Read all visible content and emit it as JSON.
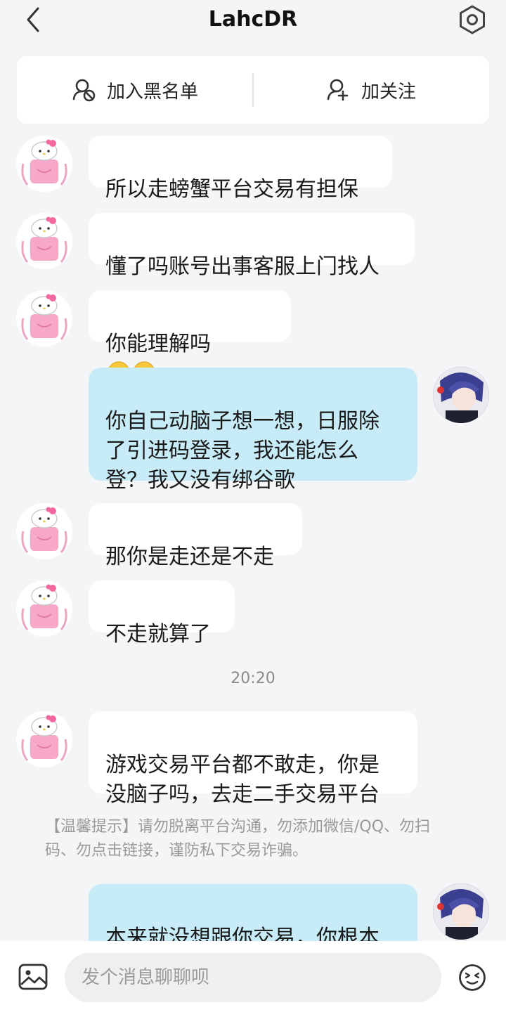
{
  "header": {
    "title": "LahcDR",
    "back_icon": "chevron-left-icon",
    "settings_icon": "gear-icon"
  },
  "actions": {
    "blacklist_label": "加入黑名单",
    "follow_label": "加关注"
  },
  "messages": [
    {
      "side": "in",
      "text": "所以走螃蟹平台交易有担保"
    },
    {
      "side": "in",
      "text": "懂了吗账号出事客服上门找人"
    },
    {
      "side": "in",
      "text": "你能理解吗",
      "emoji": "crying-laughing-emoji"
    },
    {
      "side": "out",
      "text": "你自己动脑子想一想，日服除\n了引进码登录，我还能怎么\n登？我又没有绑谷歌"
    },
    {
      "side": "in",
      "text": "那你是走还是不走"
    },
    {
      "side": "in",
      "text": "不走就算了"
    },
    {
      "side": "in",
      "text": "游戏交易平台都不敢走，你是\n没脑子吗，去走二手交易平台"
    },
    {
      "side": "out",
      "text": "本来就没想跟你交易，你根本\n就不懂怎么操作"
    }
  ],
  "timestamp": "20:20",
  "notice": "【温馨提示】请勿脱离平台沟通，勿添加微信/QQ、勿扫码、勿点击链接，谨防私下交易诈骗。",
  "input": {
    "placeholder": "发个消息聊聊呗"
  },
  "colors": {
    "background": "#f4f5f7",
    "incoming_bubble": "#ffffff",
    "outgoing_bubble": "#c7ecf8"
  }
}
